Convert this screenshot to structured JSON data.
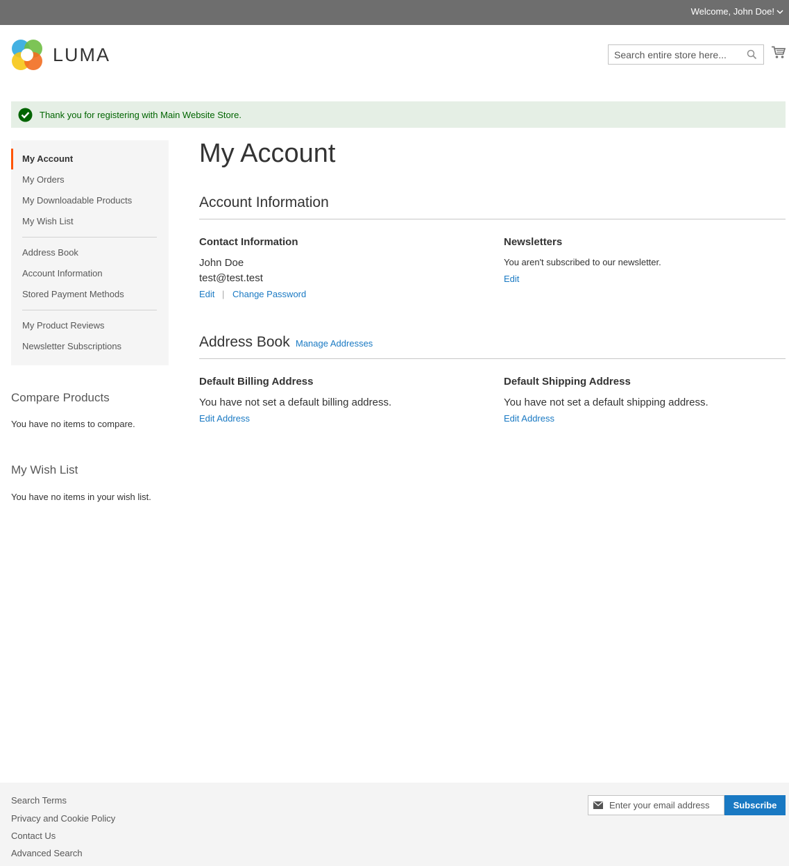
{
  "header": {
    "welcome": "Welcome, John Doe!",
    "logo_text": "LUMA",
    "search_placeholder": "Search entire store here..."
  },
  "message": {
    "text": "Thank you for registering with Main Website Store."
  },
  "sidebar": {
    "nav_groups": [
      [
        {
          "label": "My Account",
          "active": true
        },
        {
          "label": "My Orders"
        },
        {
          "label": "My Downloadable Products"
        },
        {
          "label": "My Wish List"
        }
      ],
      [
        {
          "label": "Address Book"
        },
        {
          "label": "Account Information"
        },
        {
          "label": "Stored Payment Methods"
        }
      ],
      [
        {
          "label": "My Product Reviews"
        },
        {
          "label": "Newsletter Subscriptions"
        }
      ]
    ],
    "compare": {
      "title": "Compare Products",
      "empty": "You have no items to compare."
    },
    "wishlist": {
      "title": "My Wish List",
      "empty": "You have no items in your wish list."
    }
  },
  "main": {
    "page_title": "My Account",
    "account_info": {
      "title": "Account Information",
      "contact": {
        "title": "Contact Information",
        "name": "John Doe",
        "email": "test@test.test",
        "edit_label": "Edit",
        "separator": "|",
        "change_password_label": "Change Password"
      },
      "newsletters": {
        "title": "Newsletters",
        "text": "You aren't subscribed to our newsletter.",
        "edit_label": "Edit"
      }
    },
    "address_book": {
      "title": "Address Book",
      "manage_label": "Manage Addresses",
      "billing": {
        "title": "Default Billing Address",
        "text": "You have not set a default billing address.",
        "edit_label": "Edit Address"
      },
      "shipping": {
        "title": "Default Shipping Address",
        "text": "You have not set a default shipping address.",
        "edit_label": "Edit Address"
      }
    }
  },
  "footer": {
    "links": [
      "Search Terms",
      "Privacy and Cookie Policy",
      "Contact Us",
      "Advanced Search"
    ],
    "newsletter_placeholder": "Enter your email address",
    "subscribe_label": "Subscribe"
  },
  "colors": {
    "accent": "#1979c3",
    "active_nav_border": "#ff5501",
    "success_bg": "#e5efe5",
    "success_text": "#006400",
    "topbar": "#6e6e6e"
  },
  "icons": [
    "chevron-down-icon",
    "luma-logo-icon",
    "search-icon",
    "cart-icon",
    "success-check-icon",
    "mail-icon"
  ]
}
